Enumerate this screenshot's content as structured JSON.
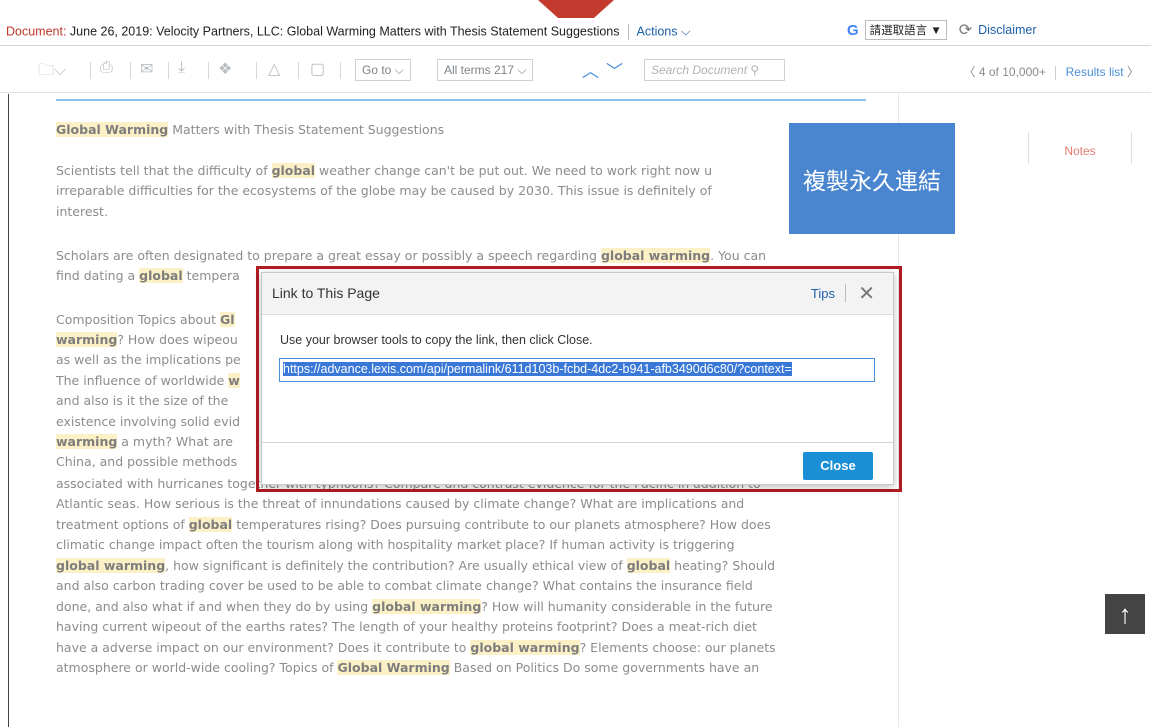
{
  "header": {
    "doc_label": "Document:",
    "doc_title": " June 26, 2019: Velocity Partners, LLC: Global Warming Matters with Thesis Statement Suggestions",
    "actions": "Actions ⌵",
    "google_logo": "G",
    "language_select": "請選取語言  ▼",
    "disclaimer": "Disclaimer"
  },
  "toolbar": {
    "goto": "Go to ⌵",
    "terms": "All terms  217 ⌵",
    "search_placeholder": "Search Document",
    "position": "4 of 10,000+",
    "results_list": "Results list"
  },
  "callout": {
    "label": "複製永久連結"
  },
  "right_panel": {
    "notes_tab": "Notes"
  },
  "document": {
    "lines": [
      [
        {
          "t": "Global Warming",
          "h": true
        },
        {
          "t": " Matters with Thesis Statement Suggestions"
        }
      ],
      [
        {
          "t": "Scientists tell that the difficulty of "
        },
        {
          "t": "global",
          "h": true
        },
        {
          "t": " weather change can't be put out. We need to work right now u"
        }
      ],
      [
        {
          "t": "irreparable difficulties for the ecosystems of the globe may be caused by 2030. This issue is definitely of"
        }
      ],
      [
        {
          "t": "interest."
        }
      ],
      [
        {
          "t": "Scholars are often designated to prepare a great essay or possibly a speech regarding "
        },
        {
          "t": "global warming",
          "h": true
        },
        {
          "t": ". You can"
        }
      ],
      [
        {
          "t": "find dating a "
        },
        {
          "t": "global",
          "h": true
        },
        {
          "t": " tempera"
        }
      ],
      [
        {
          "t": "Composition Topics about "
        },
        {
          "t": "Gl",
          "h": true
        }
      ],
      [
        {
          "t": "warming",
          "h": true
        },
        {
          "t": "? How does wipeou"
        }
      ],
      [
        {
          "t": "as well as the implications pe"
        }
      ],
      [
        {
          "t": "The influence of worldwide "
        },
        {
          "t": "w",
          "h": true
        }
      ],
      [
        {
          "t": "and also is it the size of the"
        }
      ],
      [
        {
          "t": "existence involving solid evid"
        }
      ],
      [
        {
          "t": "warming",
          "h": true
        },
        {
          "t": " a myth? What are"
        }
      ],
      [
        {
          "t": "China, and possible methods"
        }
      ],
      [
        {
          "t": "associated with hurricanes together with typhoons? Compare and contrast evidence for the Pacific in addition to"
        }
      ],
      [
        {
          "t": "Atlantic seas. How serious is the threat of innundations caused by climate change? What are implications and"
        }
      ],
      [
        {
          "t": "treatment options of "
        },
        {
          "t": "global",
          "h": true
        },
        {
          "t": " temperatures rising? Does pursuing contribute to our planets atmosphere? How does"
        }
      ],
      [
        {
          "t": "climatic change impact often the tourism along with hospitality market place? If human activity is triggering"
        }
      ],
      [
        {
          "t": "global warming",
          "h": true
        },
        {
          "t": ", how significant is definitely the contribution? Are usually ethical view of "
        },
        {
          "t": "global",
          "h": true
        },
        {
          "t": " heating? Should"
        }
      ],
      [
        {
          "t": "and also carbon trading cover be used to be able to combat climate change? What contains the insurance field"
        }
      ],
      [
        {
          "t": "done, and also what if and when they do by using "
        },
        {
          "t": "global warming",
          "h": true
        },
        {
          "t": "? How will humanity considerable in the future"
        }
      ],
      [
        {
          "t": "having current wipeout of the earths rates? The length of your healthy proteins footprint? Does a meat-rich diet"
        }
      ],
      [
        {
          "t": "have a adverse impact on our environment? Does it contribute to "
        },
        {
          "t": "global warming",
          "h": true
        },
        {
          "t": "? Elements choose: our planets"
        }
      ],
      [
        {
          "t": "atmosphere or world-wide cooling? Topics of "
        },
        {
          "t": "Global Warming",
          "h": true
        },
        {
          "t": " Based on Politics Do some governments have an"
        }
      ]
    ]
  },
  "dialog": {
    "title": "Link to This Page",
    "tips": "Tips",
    "message": "Use your browser tools to copy the link, then click Close.",
    "link": "https://advance.lexis.com/api/permalink/611d103b-fcbd-4dc2-b941-afb3490d6c80/?context=",
    "close_label": "Close"
  },
  "icons": {
    "folder": "folder-icon",
    "print": "print-icon",
    "email": "email-icon",
    "download": "download-icon",
    "dropbox": "dropbox-icon",
    "drive": "drive-icon",
    "page": "page-icon",
    "search": "search-icon",
    "scroll_top": "arrow-up-icon"
  },
  "colors": {
    "accent": "#1a8fd6",
    "highlight": "#fcf1c6",
    "callout": "#4a86cf",
    "dialog_outline": "#b01c22"
  }
}
